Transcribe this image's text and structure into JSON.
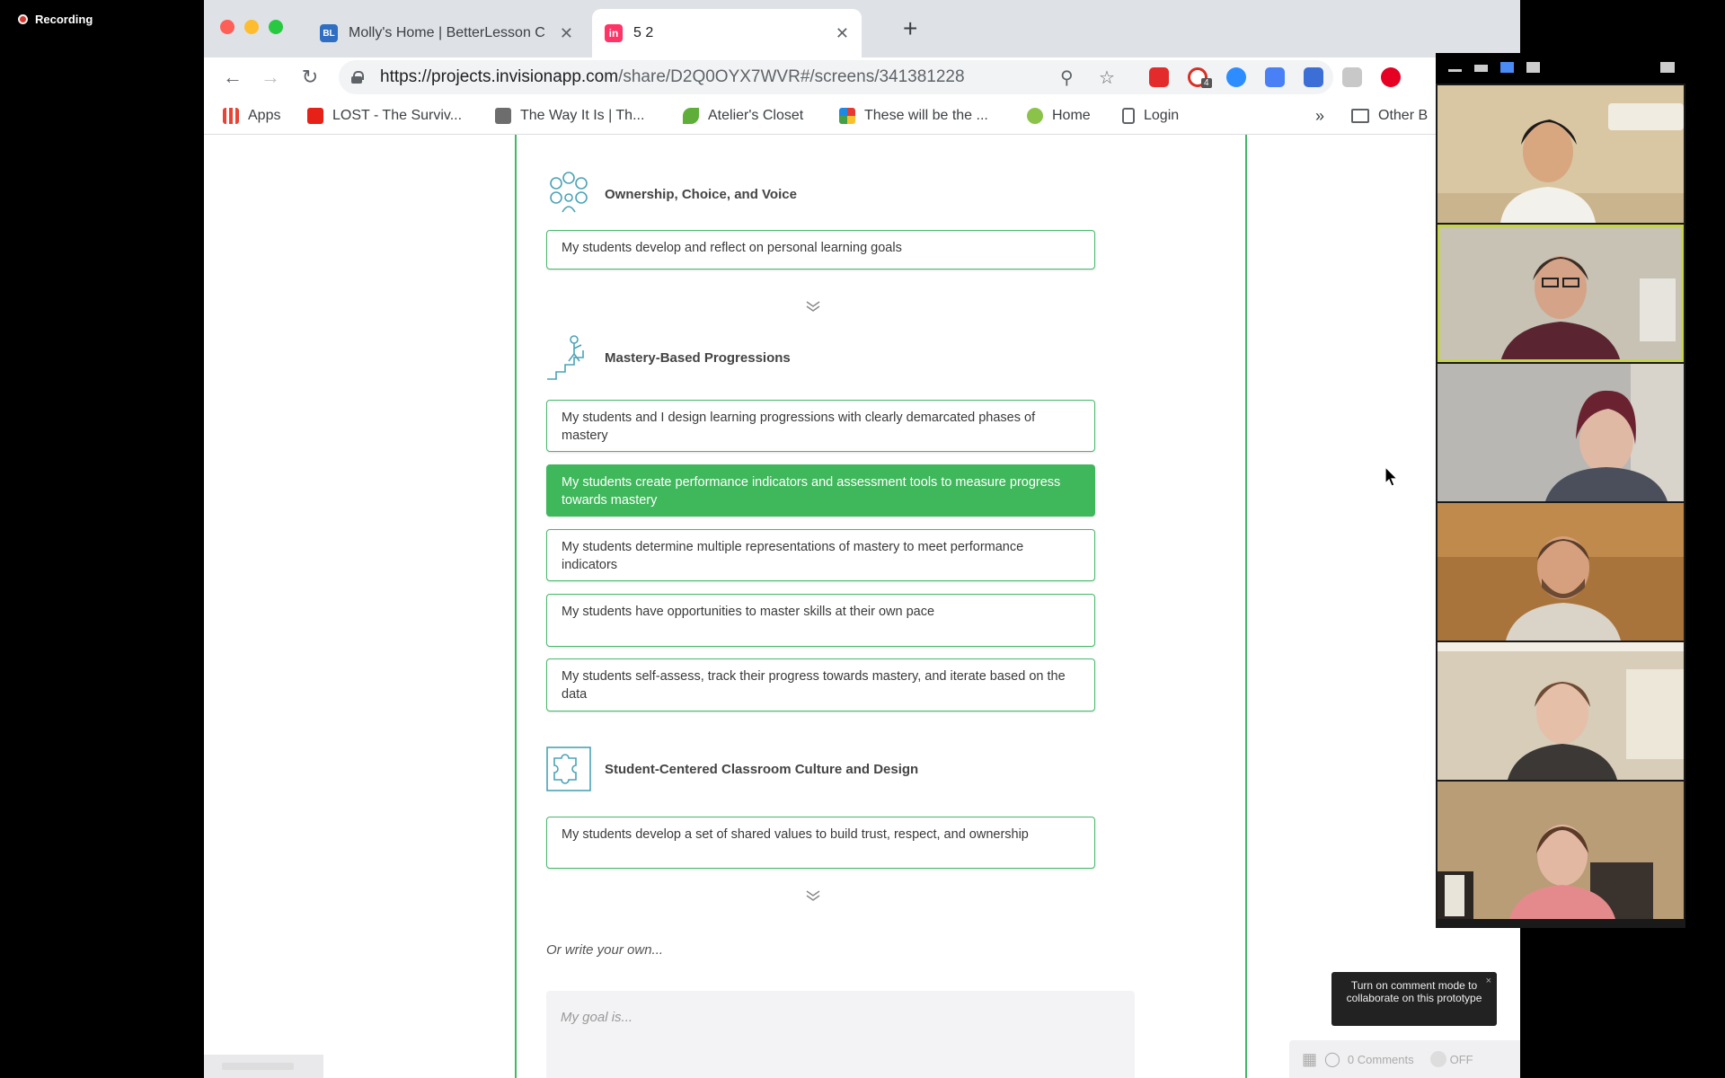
{
  "recording": {
    "label": "Recording"
  },
  "browser": {
    "tabs": [
      {
        "favicon": "BL",
        "title": "Molly's Home | BetterLesson C",
        "active": false
      },
      {
        "favicon": "in",
        "title": "5 2",
        "active": true
      }
    ],
    "url_domain": "https://projects.invisionapp.com",
    "url_path": "/share/D2Q0OYX7WVR#/screens/341381228",
    "bookmarks": [
      {
        "icon": "apps-grid-icon",
        "label": "Apps"
      },
      {
        "icon": "youtube-icon",
        "label": "LOST - The Surviv..."
      },
      {
        "icon": "image-thumb-icon",
        "label": "The Way It Is | Th..."
      },
      {
        "icon": "bird-icon",
        "label": "Atelier's Closet"
      },
      {
        "icon": "pinwheel-icon",
        "label": "These will be the ..."
      },
      {
        "icon": "green-circle-icon",
        "label": "Home"
      },
      {
        "icon": "page-icon",
        "label": "Login"
      }
    ],
    "bookmarks_more": "»",
    "other_bookmarks": "Other B",
    "extension_badge": "4"
  },
  "page": {
    "sections": [
      {
        "title": "Ownership, Choice, and Voice",
        "options": [
          {
            "text": "My students develop and reflect on personal learning goals",
            "selected": false
          }
        ]
      },
      {
        "title": "Mastery-Based Progressions",
        "options": [
          {
            "text": "My students and I design learning progressions with clearly demarcated phases of mastery",
            "selected": false
          },
          {
            "text": "My students create performance indicators and assessment tools to measure progress towards mastery",
            "selected": true
          },
          {
            "text": "My students determine multiple representations of mastery to meet performance indicators",
            "selected": false
          },
          {
            "text": "My students have opportunities to master skills at their own pace",
            "selected": false
          },
          {
            "text": "My students self-assess, track their progress towards mastery, and iterate based on the data",
            "selected": false
          }
        ]
      },
      {
        "title": "Student-Centered Classroom Culture and Design",
        "options": [
          {
            "text": "My students develop a set of shared values to build trust, respect, and ownership",
            "selected": false
          }
        ]
      }
    ],
    "write_own": "Or write your own...",
    "goal_placeholder": "My goal is...",
    "tooltip": "Turn on comment mode to collaborate on this prototype",
    "tooltip_close": "×",
    "comments": "0 Comments",
    "toggle": "OFF"
  },
  "colors": {
    "accent_green": "#3fb75b",
    "speaker_highlight": "#c6d44a"
  }
}
